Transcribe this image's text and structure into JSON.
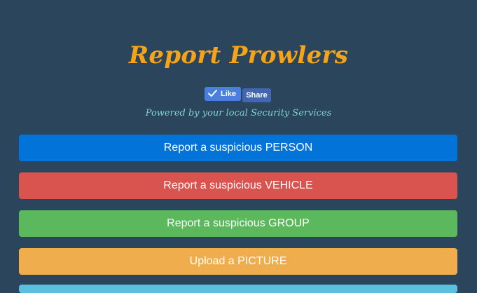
{
  "header": {
    "title": "Report Prowlers",
    "subtitle": "Powered by your local Security Services"
  },
  "social": {
    "like_label": "Like",
    "share_label": "Share",
    "like_icon": "check-icon",
    "like_color": "#4a7fe0",
    "share_color": "#4267b2"
  },
  "actions": [
    {
      "label": "Report a suspicious PERSON",
      "color": "#0274d9"
    },
    {
      "label": "Report a suspicious VEHICLE",
      "color": "#d9534f"
    },
    {
      "label": "Report a suspicious GROUP",
      "color": "#5cb85c"
    },
    {
      "label": "Upload a PICTURE",
      "color": "#f0ad4e"
    }
  ],
  "colors": {
    "background": "#2a455c",
    "title": "#f6a317",
    "subtitle": "#7fd3cf",
    "partial_button": "#5bc0de"
  }
}
